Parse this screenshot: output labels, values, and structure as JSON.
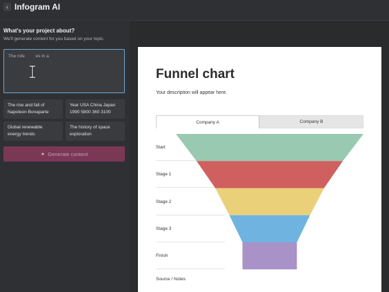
{
  "header": {
    "back_icon": "chevron-left-icon",
    "title": "Infogram AI"
  },
  "sidebar": {
    "title": "What's your project about?",
    "subtitle": "We'll generate content for you based on your topic.",
    "prompt_value": "The role ",
    "prompt_value_tail": "es in a",
    "suggestions": [
      {
        "line1": "The rise and fall of",
        "line2": "Napoleon Bonaparte"
      },
      {
        "line1": "Year USA China Japan",
        "line2": "1990 5800 360 3100"
      },
      {
        "line1": "Global renewable",
        "line2": "energy trends"
      },
      {
        "line1": "The history of space",
        "line2": "exploration"
      }
    ],
    "generate_label": "Generate content",
    "generate_icon": "sparkle-icon"
  },
  "preview": {
    "title": "Funnel chart",
    "description": "Your description will appear here.",
    "tabs": [
      "Company A",
      "Company B"
    ],
    "source_note": "Source / Notes"
  },
  "chart_data": {
    "type": "funnel",
    "categories": [
      "Start",
      "Stage 1",
      "Stage 2",
      "Stage 3",
      "Finish"
    ],
    "values": [
      100,
      78,
      58,
      43,
      29
    ],
    "colors": [
      "#9ac9b1",
      "#d06060",
      "#ebd07a",
      "#6fb4e0",
      "#a892c8"
    ]
  }
}
